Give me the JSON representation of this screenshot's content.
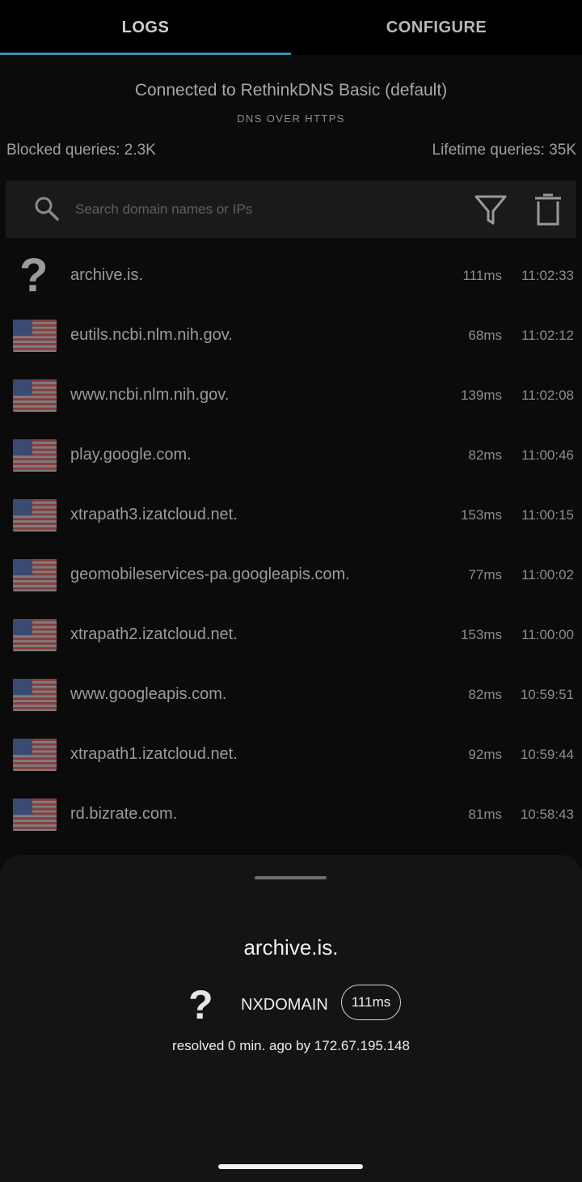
{
  "tabs": {
    "logs": "LOGS",
    "configure": "CONFIGURE"
  },
  "status": {
    "connection": "Connected to RethinkDNS Basic (default)",
    "protocol": "DNS OVER HTTPS",
    "blocked": "Blocked queries: 2.3K",
    "lifetime": "Lifetime queries: 35K"
  },
  "search": {
    "placeholder": "Search domain names or IPs",
    "value": ""
  },
  "colors": {
    "accent": "#3e8ea8",
    "background": "#0b0b0b",
    "sheet": "#141414"
  },
  "logs": [
    {
      "flag": "unknown",
      "icon": "?",
      "domain": "archive.is.",
      "latency": "111ms",
      "time": "11:02:33"
    },
    {
      "flag": "us",
      "domain": "eutils.ncbi.nlm.nih.gov.",
      "latency": "68ms",
      "time": "11:02:12"
    },
    {
      "flag": "us",
      "domain": "www.ncbi.nlm.nih.gov.",
      "latency": "139ms",
      "time": "11:02:08"
    },
    {
      "flag": "us",
      "domain": "play.google.com.",
      "latency": "82ms",
      "time": "11:00:46"
    },
    {
      "flag": "us",
      "domain": "xtrapath3.izatcloud.net.",
      "latency": "153ms",
      "time": "11:00:15"
    },
    {
      "flag": "us",
      "domain": "geomobileservices-pa.googleapis.com.",
      "latency": "77ms",
      "time": "11:00:02"
    },
    {
      "flag": "us",
      "domain": "xtrapath2.izatcloud.net.",
      "latency": "153ms",
      "time": "11:00:00"
    },
    {
      "flag": "us",
      "domain": "www.googleapis.com.",
      "latency": "82ms",
      "time": "10:59:51"
    },
    {
      "flag": "us",
      "domain": "xtrapath1.izatcloud.net.",
      "latency": "92ms",
      "time": "10:59:44"
    },
    {
      "flag": "us",
      "domain": "rd.bizrate.com.",
      "latency": "81ms",
      "time": "10:58:43"
    }
  ],
  "sheet": {
    "domain": "archive.is.",
    "icon": "?",
    "status": "NXDOMAIN",
    "latency": "111ms",
    "resolved": "resolved 0 min. ago by 172.67.195.148"
  }
}
